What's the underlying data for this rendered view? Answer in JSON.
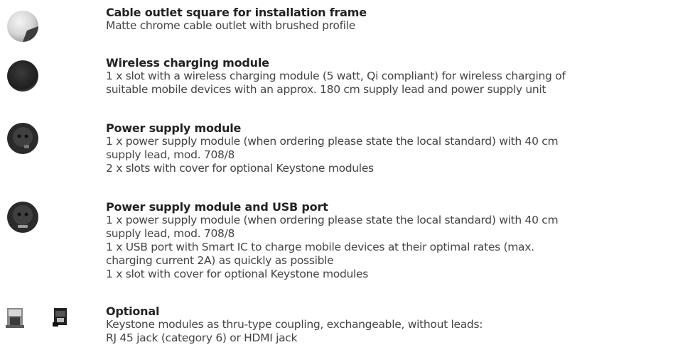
{
  "items": [
    {
      "title": "Cable outlet square for installation frame",
      "lines": [
        "Matte chrome cable outlet with brushed profile"
      ],
      "icon": "cable-outlet-icon"
    },
    {
      "title": "Wireless charging module",
      "lines": [
        "1 x slot with a wireless charging module (5 watt, Qi compliant) for wireless charging of",
        "suitable mobile devices with an approx. 180 cm supply lead and power supply unit"
      ],
      "icon": "wireless-charger-icon"
    },
    {
      "title": "Power supply module",
      "lines": [
        "1 x power supply module (when ordering please state the local standard) with 40 cm",
        "supply lead, mod. 708/8",
        "2 x slots with cover for optional Keystone modules"
      ],
      "icon": "power-socket-icon"
    },
    {
      "title": "Power supply module and USB port",
      "lines": [
        "1 x power supply module (when ordering please state the local standard) with 40 cm",
        "supply lead, mod. 708/8",
        "1 x USB port with Smart IC to charge mobile devices at their optimal rates (max.",
        "charging current 2A) as quickly as possible",
        "1 x slot with cover for optional Keystone modules"
      ],
      "icon": "power-socket-usb-icon"
    },
    {
      "title": "Optional",
      "lines": [
        "Keystone modules as thru-type coupling, exchangeable, without leads:",
        "RJ 45 jack (category 6) or HDMI jack"
      ],
      "icon": "keystone-modules-icon"
    }
  ]
}
